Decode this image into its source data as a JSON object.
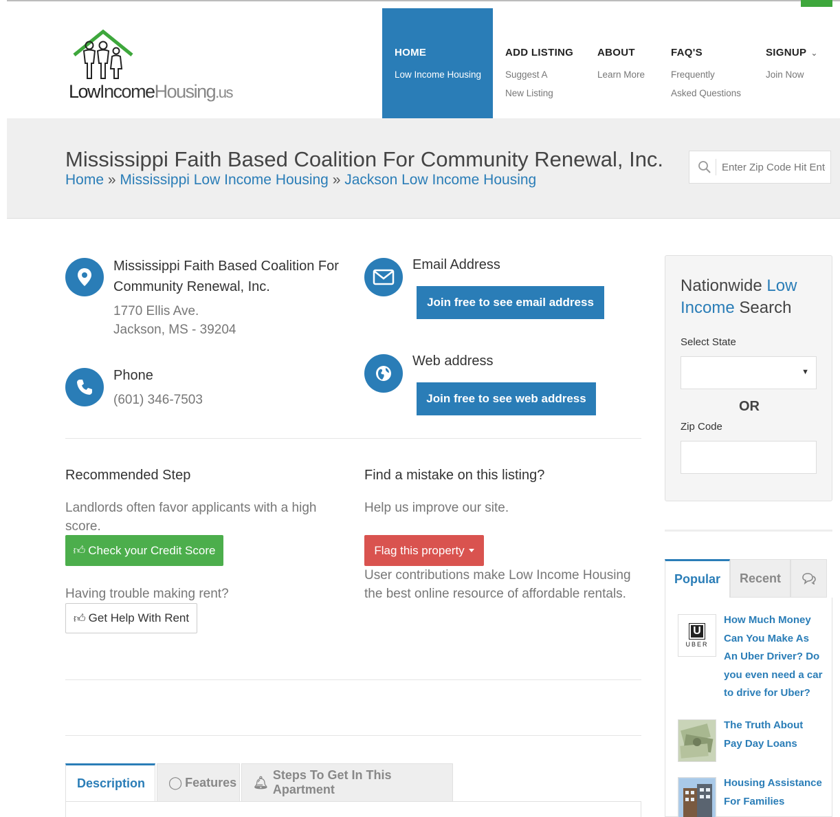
{
  "logo": {
    "part1": "Low",
    "part2": "Income",
    "part3": "Housing",
    "part4": ".us"
  },
  "nav": [
    {
      "title": "HOME",
      "sub": [
        "Low Income Housing"
      ]
    },
    {
      "title": "ADD LISTING",
      "sub": [
        "Suggest A",
        "New Listing"
      ]
    },
    {
      "title": "ABOUT",
      "sub": [
        "Learn More"
      ]
    },
    {
      "title": "FAQ'S",
      "sub": [
        "Frequently",
        "Asked Questions"
      ]
    },
    {
      "title": "SIGNUP",
      "sub": [
        "Join Now"
      ]
    }
  ],
  "title": "Mississippi Faith Based Coalition For Community Renewal, Inc.",
  "breadcrumb": {
    "home": "Home",
    "sep": "»",
    "state": "Mississippi Low Income Housing",
    "city": "Jackson Low Income Housing"
  },
  "search": {
    "placeholder": "Enter Zip Code Hit Enter"
  },
  "listing": {
    "name": "Mississippi Faith Based Coalition For Community Renewal, Inc.",
    "address_line1": "1770 Ellis Ave.",
    "address_line2": "Jackson, MS - 39204",
    "phone_label": "Phone",
    "phone": "(601) 346-7503",
    "email_label": "Email Address",
    "email_button": "Join free to see email address",
    "web_label": "Web address",
    "web_button": "Join free to see web address"
  },
  "recommended": {
    "heading": "Recommended Step",
    "text": "Landlords often favor applicants with a high score.",
    "credit_button": "Check your Credit Score",
    "rent_question": "Having trouble making rent?",
    "rent_button": "Get Help With Rent"
  },
  "mistake": {
    "heading": "Find a mistake on this listing?",
    "text": "Help us improve our site.",
    "flag_button": "Flag this property",
    "note": "User contributions make Low Income Housing the best online resource of affordable rentals."
  },
  "tabs": [
    "Description",
    "Features",
    "Steps To Get In This Apartment"
  ],
  "sidebar": {
    "title_1": "Nationwide ",
    "title_2": "Low",
    "title_3": "Income",
    "title_4": " Search",
    "state_label": "Select State",
    "or": "OR",
    "zip_label": "Zip Code",
    "tabs": [
      "Popular",
      "Recent"
    ],
    "uber_text": "UBER",
    "posts": [
      "How Much Money Can You Make As An Uber Driver? Do you even need a car to drive for Uber?",
      "The Truth About Pay Day Loans",
      "Housing Assistance For Families"
    ]
  },
  "colors": {
    "primary": "#2a7db7",
    "green": "#4cae4c",
    "red": "#d9534f"
  }
}
